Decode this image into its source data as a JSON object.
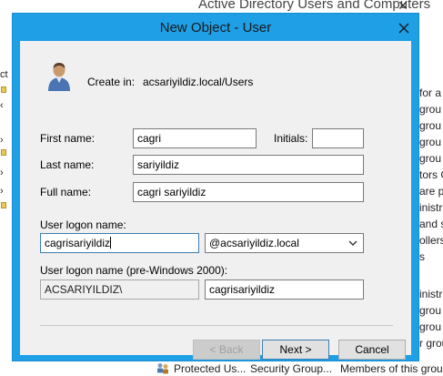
{
  "background_app": {
    "title": "Active Directory Users and Computers",
    "close_glyph": "✕",
    "left_fragments": [
      "ct",
      "‹",
      "›",
      "›",
      "›"
    ],
    "list_fragments": [
      "for a",
      "grou",
      "grou",
      "grou",
      "grou",
      "tors G",
      "are p",
      "inistr",
      "and s",
      "ollers",
      "s",
      "inistr",
      "grou",
      "grou",
      "r grou"
    ],
    "bottom_row": {
      "icon": "group-icon",
      "name": "Protected Us...",
      "type": "Security Group...",
      "description": "Members of this group"
    }
  },
  "dialog": {
    "title": "New Object - User",
    "close_icon": "close-icon",
    "create_in_label": "Create in:",
    "create_in_path": "acsariyildiz.local/Users",
    "first_name": {
      "label": "First name:",
      "value": "cagri"
    },
    "initials": {
      "label": "Initials:",
      "value": ""
    },
    "last_name": {
      "label": "Last name:",
      "value": "sariyildiz"
    },
    "full_name": {
      "label": "Full name:",
      "value": "cagri sariyildiz"
    },
    "logon": {
      "label": "User logon name:",
      "value": "cagrisariyildiz",
      "domain": "@acsariyildiz.local"
    },
    "logon_pre2000": {
      "label": "User logon name (pre-Windows 2000):",
      "domain": "ACSARIYILDIZ\\",
      "value": "cagrisariyildiz"
    },
    "buttons": {
      "back": "< Back",
      "next": "Next >",
      "cancel": "Cancel"
    }
  },
  "colors": {
    "title_bar": "#1e9fe6",
    "dialog_face": "#f0f0f0",
    "focus_border": "#3c7fb1"
  }
}
